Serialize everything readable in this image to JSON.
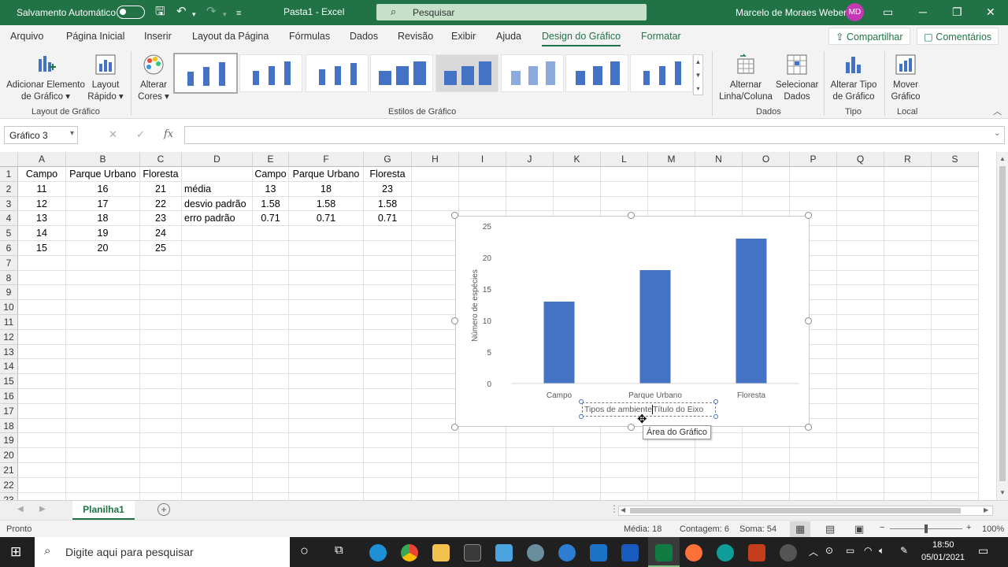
{
  "titlebar": {
    "autosave_label": "Salvamento Automático",
    "document_title": "Pasta1  -  Excel",
    "search_placeholder": "Pesquisar",
    "user_name": "Marcelo de Moraes Weber",
    "user_initials": "MD",
    "brand_color": "#217346"
  },
  "tabs": [
    {
      "label": "Arquivo"
    },
    {
      "label": "Página Inicial"
    },
    {
      "label": "Inserir"
    },
    {
      "label": "Layout da Página"
    },
    {
      "label": "Fórmulas"
    },
    {
      "label": "Dados"
    },
    {
      "label": "Revisão"
    },
    {
      "label": "Exibir"
    },
    {
      "label": "Ajuda"
    },
    {
      "label": "Design do Gráfico"
    },
    {
      "label": "Formatar"
    }
  ],
  "share_label": "Compartilhar",
  "comments_label": "Comentários",
  "ribbon": {
    "add_element": "Adicionar Elemento de Gráfico",
    "quick_layout": "Layout Rápido",
    "group_layout": "Layout de Gráfico",
    "change_colors": "Alterar Cores",
    "group_styles": "Estilos de Gráfico",
    "switch_rowcol": "Alternar Linha/Coluna",
    "select_data": "Selecionar Dados",
    "group_data": "Dados",
    "change_type": "Alterar Tipo de Gráfico",
    "group_type": "Tipo",
    "move_chart": "Mover Gráfico",
    "group_location": "Local"
  },
  "formula_bar": {
    "name_box": "Gráfico 3",
    "fx": "fx",
    "value": ""
  },
  "grid": {
    "columns": [
      "A",
      "B",
      "C",
      "D",
      "E",
      "F",
      "G",
      "H",
      "I",
      "J",
      "K",
      "L",
      "M",
      "N",
      "O",
      "P",
      "Q",
      "R",
      "S"
    ],
    "rows": [
      "1",
      "2",
      "3",
      "4",
      "5",
      "6",
      "7",
      "8",
      "9",
      "10",
      "11",
      "12",
      "13",
      "14",
      "15",
      "16",
      "17",
      "18",
      "19",
      "20",
      "21",
      "22",
      "23"
    ],
    "cells": {
      "A1": "Campo",
      "B1": "Parque Urbano",
      "C1": "Floresta",
      "A2": "11",
      "B2": "16",
      "C2": "21",
      "A3": "12",
      "B3": "17",
      "C3": "22",
      "A4": "13",
      "B4": "18",
      "C4": "23",
      "A5": "14",
      "B5": "19",
      "C5": "24",
      "A6": "15",
      "B6": "20",
      "C6": "25",
      "D2": "média",
      "D3": "desvio padrão",
      "D4": "erro padrão",
      "E1": "Campo",
      "F1": "Parque Urbano",
      "G1": "Floresta",
      "E2": "13",
      "F2": "18",
      "G2": "23",
      "E3": "1.58",
      "F3": "1.58",
      "G3": "1.58",
      "E4": "0.71",
      "F4": "0.71",
      "G4": "0.71"
    }
  },
  "chart_data": {
    "type": "bar",
    "categories": [
      "Campo",
      "Parque Urbano",
      "Floresta"
    ],
    "values": [
      13,
      18,
      23
    ],
    "ylabel": "Número de espécies",
    "xlabel": "Tipos de ambiente",
    "xlabel_placeholder": "Título do Eixo",
    "ylim": [
      0,
      25
    ],
    "yticks": [
      0,
      5,
      10,
      15,
      20,
      25
    ],
    "bar_color": "#4472c4",
    "grid": false
  },
  "chart_tooltip": "Área do Gráfico",
  "sheet_tab": "Planilha1",
  "status": {
    "ready": "Pronto",
    "average": "Média: 18",
    "count": "Contagem: 6",
    "sum": "Soma: 54",
    "zoom": "100%"
  },
  "taskbar": {
    "search_placeholder": "Digite aqui para pesquisar",
    "time": "18:50",
    "date": "05/01/2021"
  }
}
